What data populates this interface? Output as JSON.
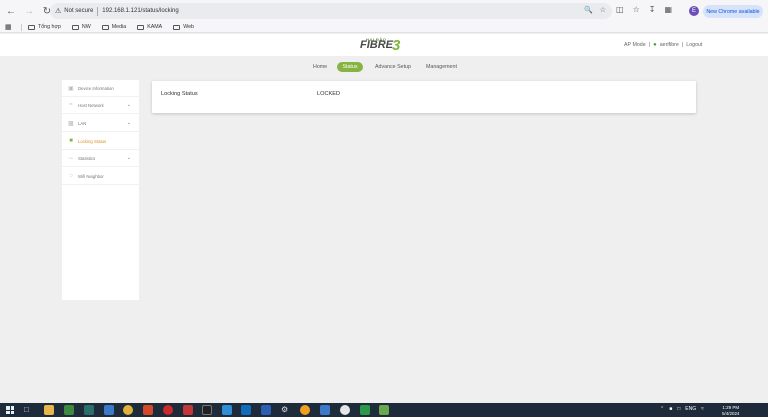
{
  "browser": {
    "security_label": "Not secure",
    "url": "192.168.1.121/status/locking",
    "new_chrome": "New Chrome available",
    "profile_initial": "E",
    "bookmarks": [
      "Tổng hợp",
      "NW",
      "Media",
      "KAMA",
      "Web"
    ]
  },
  "header": {
    "logo_top": "HAI ĐÃO",
    "logo_main": "FIBRE",
    "logo_number": "3",
    "mode": "AP Mode",
    "user": "aerifibre",
    "logout": "Logout",
    "separator": "|"
  },
  "topnav": [
    "Home",
    "Status",
    "Advance Setup",
    "Management"
  ],
  "sidebar": {
    "items": [
      {
        "label": "Device Information",
        "icon": "device-icon",
        "has_children": false,
        "active": false
      },
      {
        "label": "Host Network",
        "icon": "wifi-icon",
        "has_children": true,
        "active": false
      },
      {
        "label": "LAN",
        "icon": "lan-icon",
        "has_children": true,
        "active": false
      },
      {
        "label": "Locking Status",
        "icon": "lock-icon",
        "has_children": false,
        "active": true
      },
      {
        "label": "Statistics",
        "icon": "chart-icon",
        "has_children": true,
        "active": false
      },
      {
        "label": "Wifi Neighbor",
        "icon": "neighbor-icon",
        "has_children": false,
        "active": false
      }
    ]
  },
  "panel": {
    "label": "Locking Status",
    "value": "LOCKED"
  },
  "taskbar": {
    "language": "ENG",
    "time": "1:29 PM",
    "date": "5/4/2024"
  },
  "colors": {
    "accent_green": "#86b442",
    "active_orange": "#d7901f",
    "taskbar_bg": "#1d2b3a"
  }
}
